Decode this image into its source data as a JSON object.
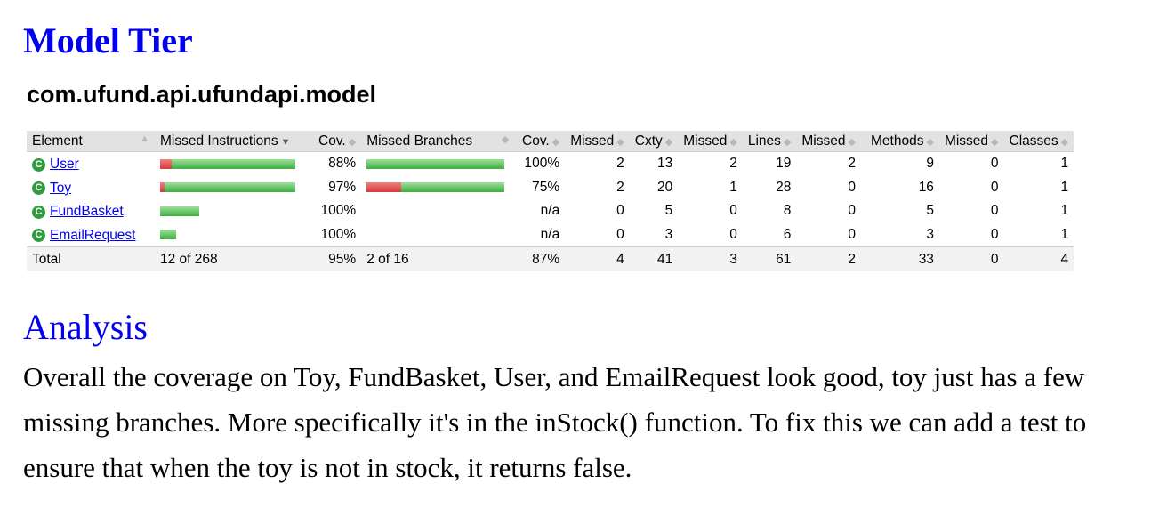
{
  "title": "Model Tier",
  "package": "com.ufund.api.ufundapi.model",
  "table": {
    "headers": [
      "Element",
      "Missed Instructions",
      "Cov.",
      "Missed Branches",
      "Cov.",
      "Missed",
      "Cxty",
      "Missed",
      "Lines",
      "Missed",
      "Methods",
      "Missed",
      "Classes"
    ],
    "sort_icon": "sort-icon",
    "sort_active_icon": "sort-desc-icon",
    "rows": [
      {
        "name": "User",
        "icon": "class-icon",
        "instr_missed_frac": 0.088,
        "instr_cov": "88%",
        "branch_missed_frac": 0.0,
        "branch_cov": "100%",
        "cxty_missed": "2",
        "cxty": "13",
        "lines_missed": "2",
        "lines": "19",
        "methods_missed": "2",
        "methods": "9",
        "classes_missed": "0",
        "classes": "1"
      },
      {
        "name": "Toy",
        "icon": "class-icon",
        "instr_missed_frac": 0.03,
        "instr_cov": "97%",
        "branch_missed_frac": 0.25,
        "branch_cov": "75%",
        "cxty_missed": "2",
        "cxty": "20",
        "lines_missed": "1",
        "lines": "28",
        "methods_missed": "0",
        "methods": "16",
        "classes_missed": "0",
        "classes": "1"
      },
      {
        "name": "FundBasket",
        "icon": "class-icon",
        "instr_missed_frac": 0.0,
        "instr_cov": "100%",
        "branch_missed_frac": null,
        "branch_cov": "n/a",
        "cxty_missed": "0",
        "cxty": "5",
        "lines_missed": "0",
        "lines": "8",
        "methods_missed": "0",
        "methods": "5",
        "classes_missed": "0",
        "classes": "1"
      },
      {
        "name": "EmailRequest",
        "icon": "class-icon",
        "instr_missed_frac": 0.0,
        "instr_cov": "100%",
        "branch_missed_frac": null,
        "branch_cov": "n/a",
        "cxty_missed": "0",
        "cxty": "3",
        "lines_missed": "0",
        "lines": "6",
        "methods_missed": "0",
        "methods": "3",
        "classes_missed": "0",
        "classes": "1"
      }
    ],
    "total": {
      "label": "Total",
      "instr": "12 of 268",
      "instr_cov": "95%",
      "branch": "2 of 16",
      "branch_cov": "87%",
      "cxty_missed": "4",
      "cxty": "41",
      "lines_missed": "3",
      "lines": "61",
      "methods_missed": "2",
      "methods": "33",
      "classes_missed": "0",
      "classes": "4"
    },
    "colors": {
      "missed": "#d43b3b",
      "covered": "#3fae3f",
      "header_bg": "#e2e2e2",
      "link": "#0000ee"
    }
  },
  "analysis": {
    "heading": "Analysis",
    "text": "Overall the coverage on Toy, FundBasket, User, and EmailRequest look good, toy just has a few missing branches. More specifically it's in the inStock() function. To fix this we can add a test to ensure that when the toy is not in stock, it returns false."
  }
}
